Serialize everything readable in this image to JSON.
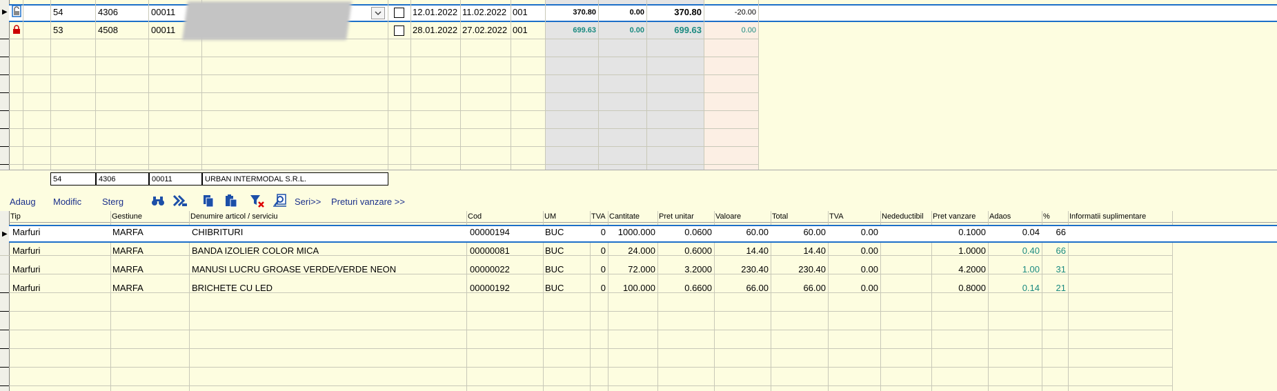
{
  "top_grid": {
    "rows": [
      {
        "nr": "54",
        "doc": "4306",
        "code": "00011",
        "date1": "12.01.2022",
        "date2": "11.02.2022",
        "gest": "001",
        "v1": "370.80",
        "v2": "0.00",
        "v3": "370.80",
        "v4": "-20.00",
        "lock": "open"
      },
      {
        "nr": "53",
        "doc": "4508",
        "code": "00011",
        "date1": "28.01.2022",
        "date2": "27.02.2022",
        "gest": "001",
        "v1": "699.63",
        "v2": "0.00",
        "v3": "699.63",
        "v4": "0.00",
        "lock": "closed"
      }
    ]
  },
  "summary": {
    "nr": "54",
    "doc": "4306",
    "code": "00011",
    "partner": "URBAN INTERMODAL S.R.L."
  },
  "toolbar": {
    "adaug": "Adaug",
    "modific": "Modific",
    "sterg": "Sterg",
    "seri": "Seri>>",
    "preturi": "Preturi vanzare >>",
    "icons": [
      "binoculars-icon",
      "excel-icon",
      "copy-icon",
      "paste-icon",
      "filter-clear-icon",
      "print-preview-icon"
    ]
  },
  "bottom_grid": {
    "headers": {
      "tip": "Tip",
      "gestiune": "Gestiune",
      "denumire": "Denumire articol / serviciu",
      "cod": "Cod",
      "um": "UM",
      "tva": "TVA",
      "cantitate": "Cantitate",
      "pret_unitar": "Pret unitar",
      "valoare": "Valoare",
      "total": "Total",
      "tva2": "TVA",
      "nedeductibil": "Nedeductibil",
      "pret_vanzare": "Pret vanzare",
      "adaos": "Adaos",
      "pct": "%",
      "info": "Informatii suplimentare"
    },
    "rows": [
      {
        "tip": "Marfuri",
        "gestiune": "MARFA",
        "denumire": "CHIBRITURI",
        "cod": "00000194",
        "um": "BUC",
        "tva": "0",
        "cantitate": "1000.000",
        "pret_unitar": "0.0600",
        "valoare": "60.00",
        "total": "60.00",
        "tva2": "0.00",
        "pret_vanzare": "0.1000",
        "adaos": "0.04",
        "pct": "66"
      },
      {
        "tip": "Marfuri",
        "gestiune": "MARFA",
        "denumire": "BANDA IZOLIER COLOR MICA",
        "cod": "00000081",
        "um": "BUC",
        "tva": "0",
        "cantitate": "24.000",
        "pret_unitar": "0.6000",
        "valoare": "14.40",
        "total": "14.40",
        "tva2": "0.00",
        "pret_vanzare": "1.0000",
        "adaos": "0.40",
        "pct": "66"
      },
      {
        "tip": "Marfuri",
        "gestiune": "MARFA",
        "denumire": "MANUSI LUCRU GROASE VERDE/VERDE NEON",
        "cod": "00000022",
        "um": "BUC",
        "tva": "0",
        "cantitate": "72.000",
        "pret_unitar": "3.2000",
        "valoare": "230.40",
        "total": "230.40",
        "tva2": "0.00",
        "pret_vanzare": "4.2000",
        "adaos": "1.00",
        "pct": "31"
      },
      {
        "tip": "Marfuri",
        "gestiune": "MARFA",
        "denumire": "BRICHETE CU LED",
        "cod": "00000192",
        "um": "BUC",
        "tva": "0",
        "cantitate": "100.000",
        "pret_unitar": "0.6600",
        "valoare": "66.00",
        "total": "66.00",
        "tva2": "0.00",
        "pret_vanzare": "0.8000",
        "adaos": "0.14",
        "pct": "21"
      }
    ]
  },
  "colors": {
    "selection": "#1c6fc8",
    "background": "#fdfde0",
    "teal": "#1a8a80",
    "link": "#1a2f8a"
  }
}
